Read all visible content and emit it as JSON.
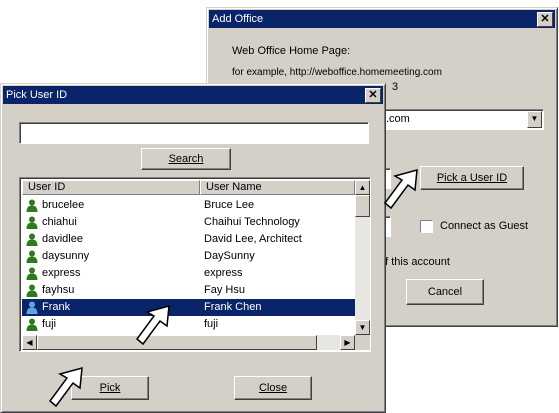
{
  "add_office": {
    "title": "Add Office",
    "close_label": "✕",
    "home_page_label": "Web Office Home Page:",
    "example_text": "for example, http://weboffice.homemeeting.com",
    "partial_digit": "3",
    "url_value": ".com",
    "pick_user_id_label": "Pick a User ID",
    "connect_guest_label": "Connect as Guest",
    "account_text": "of this account",
    "cancel_label": "Cancel"
  },
  "pick_user": {
    "title": "Pick User ID",
    "close_label": "✕",
    "search_value": "",
    "search_label": "Search",
    "columns": [
      "User ID",
      "User Name"
    ],
    "rows": [
      {
        "id": "brucelee",
        "name": "Bruce Lee"
      },
      {
        "id": "chiahui",
        "name": "Chaihui Technology"
      },
      {
        "id": "davidlee",
        "name": "David Lee, Architect"
      },
      {
        "id": "daysunny",
        "name": "DaySunny"
      },
      {
        "id": "express",
        "name": "express"
      },
      {
        "id": "fayhsu",
        "name": "Fay Hsu"
      },
      {
        "id": "Frank",
        "name": "Frank Chen"
      },
      {
        "id": "fuji",
        "name": "fuji"
      }
    ],
    "selected_index": 6,
    "pick_label": "Pick",
    "close_button_label": "Close"
  }
}
